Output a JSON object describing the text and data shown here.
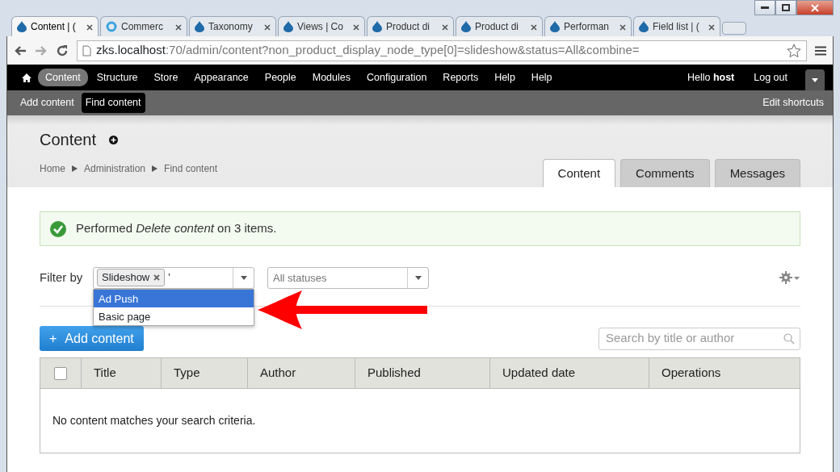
{
  "browser": {
    "tabs": [
      {
        "title": "Content | (",
        "kind": "drop",
        "selected": true
      },
      {
        "title": "Commerc",
        "kind": "ring",
        "selected": false
      },
      {
        "title": "Taxonomy",
        "kind": "drop",
        "selected": false
      },
      {
        "title": "Views | Co",
        "kind": "drop",
        "selected": false
      },
      {
        "title": "Product di",
        "kind": "drop",
        "selected": false
      },
      {
        "title": "Product di",
        "kind": "drop",
        "selected": false
      },
      {
        "title": "Performan",
        "kind": "drop",
        "selected": false
      },
      {
        "title": "Field list | (",
        "kind": "drop",
        "selected": false
      }
    ],
    "address": {
      "host": "zks.localhost",
      "path": ":70/admin/content?non_product_display_node_type[0]=slideshow&status=All&combine="
    }
  },
  "toolbar": {
    "items": [
      {
        "label": "Content",
        "selected": true
      },
      {
        "label": "Structure",
        "selected": false
      },
      {
        "label": "Store",
        "selected": false
      },
      {
        "label": "Appearance",
        "selected": false
      },
      {
        "label": "People",
        "selected": false
      },
      {
        "label": "Modules",
        "selected": false
      },
      {
        "label": "Configuration",
        "selected": false
      },
      {
        "label": "Reports",
        "selected": false
      },
      {
        "label": "Help",
        "selected": false
      },
      {
        "label": "Help",
        "selected": false
      }
    ],
    "greeting": "Hello **host**",
    "logout": "Log out"
  },
  "shortcuts": {
    "items": [
      {
        "label": "Add content",
        "selected": false
      },
      {
        "label": "Find content",
        "selected": true
      }
    ],
    "edit": "Edit shortcuts"
  },
  "page": {
    "title": "Content",
    "breadcrumb": [
      "Home",
      "Administration",
      "Find content"
    ],
    "tabs": [
      {
        "label": "Content",
        "selected": true
      },
      {
        "label": "Comments",
        "selected": false
      },
      {
        "label": "Messages",
        "selected": false
      }
    ]
  },
  "message": {
    "text": "Performed *Delete content* on 3 items."
  },
  "filter": {
    "label": "Filter by",
    "type_field": {
      "tags": [
        "Slideshow"
      ],
      "value": "'"
    },
    "type_options": [
      {
        "label": "Ad Push",
        "selected": true
      },
      {
        "label": "Basic page",
        "selected": false
      }
    ],
    "status_field": {
      "placeholder": "All statuses"
    }
  },
  "add_button": {
    "icon": "+",
    "label": "Add content"
  },
  "search": {
    "placeholder": "Search by title or author"
  },
  "table": {
    "select_all_checked": false,
    "columns": [
      "Title",
      "Type",
      "Author",
      "Published",
      "Updated date",
      "Operations"
    ],
    "empty": "No content matches your search criteria."
  }
}
